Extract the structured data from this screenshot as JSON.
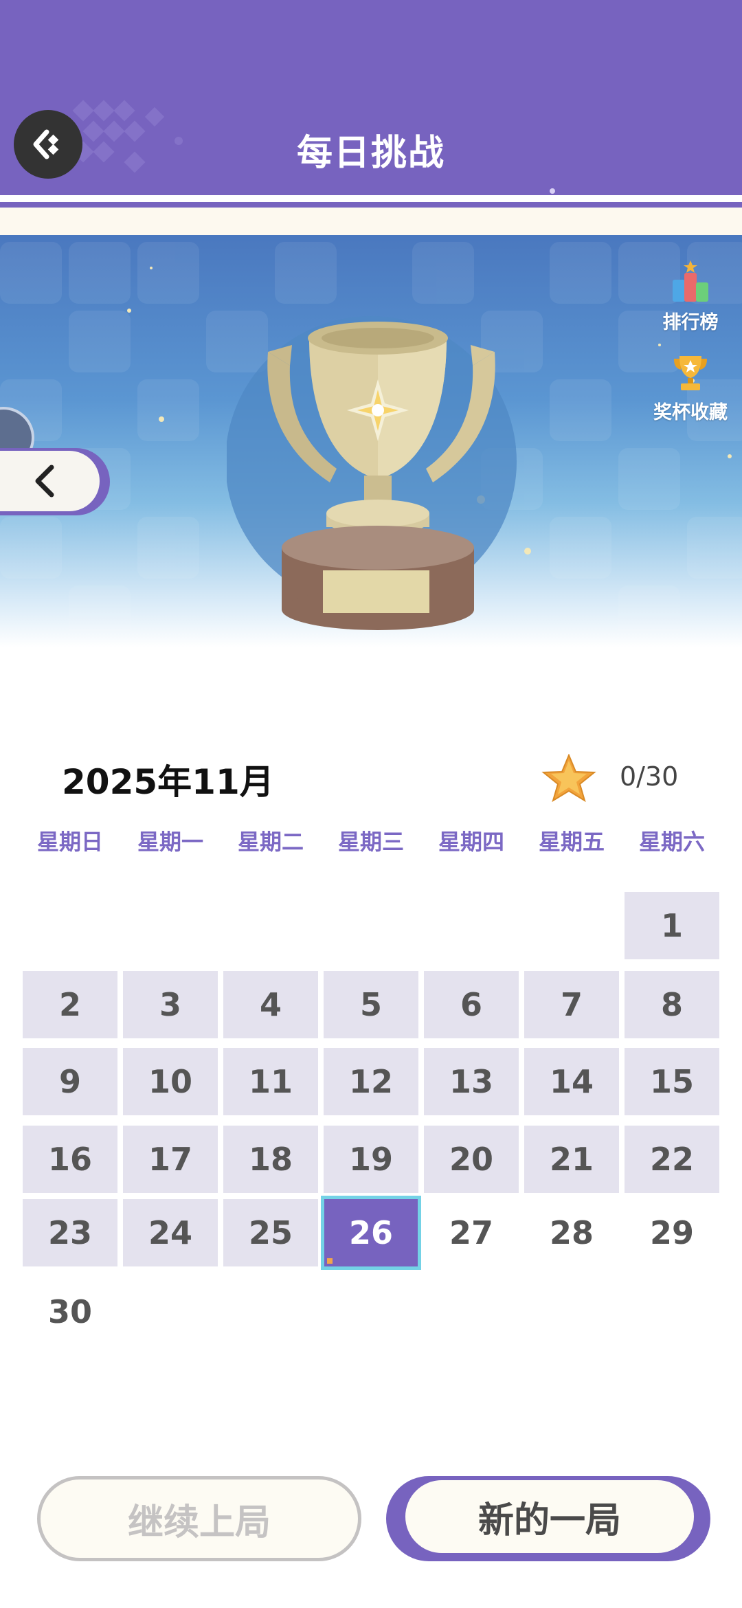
{
  "header": {
    "title": "每日挑战",
    "back_icon": "back-diamond-icon"
  },
  "banner": {
    "leaderboard_label": "排行榜",
    "trophy_collection_label": "奖杯收藏",
    "prev_icon": "chevron-left-icon"
  },
  "calendar": {
    "month_title": "2025年11月",
    "stars": "0/30",
    "weekdays": [
      "星期日",
      "星期一",
      "星期二",
      "星期三",
      "星期四",
      "星期五",
      "星期六"
    ],
    "days": [
      "1",
      "2",
      "3",
      "4",
      "5",
      "6",
      "7",
      "8",
      "9",
      "10",
      "11",
      "12",
      "13",
      "14",
      "15",
      "16",
      "17",
      "18",
      "19",
      "20",
      "21",
      "22",
      "23",
      "24",
      "25",
      "26",
      "27",
      "28",
      "29",
      "30"
    ],
    "today": "26"
  },
  "buttons": {
    "continue_label": "继续上局",
    "new_game_label": "新的一局"
  },
  "colors": {
    "accent": "#7763bf",
    "today_border": "#74d2e6",
    "tile": "#e4e2ee"
  }
}
